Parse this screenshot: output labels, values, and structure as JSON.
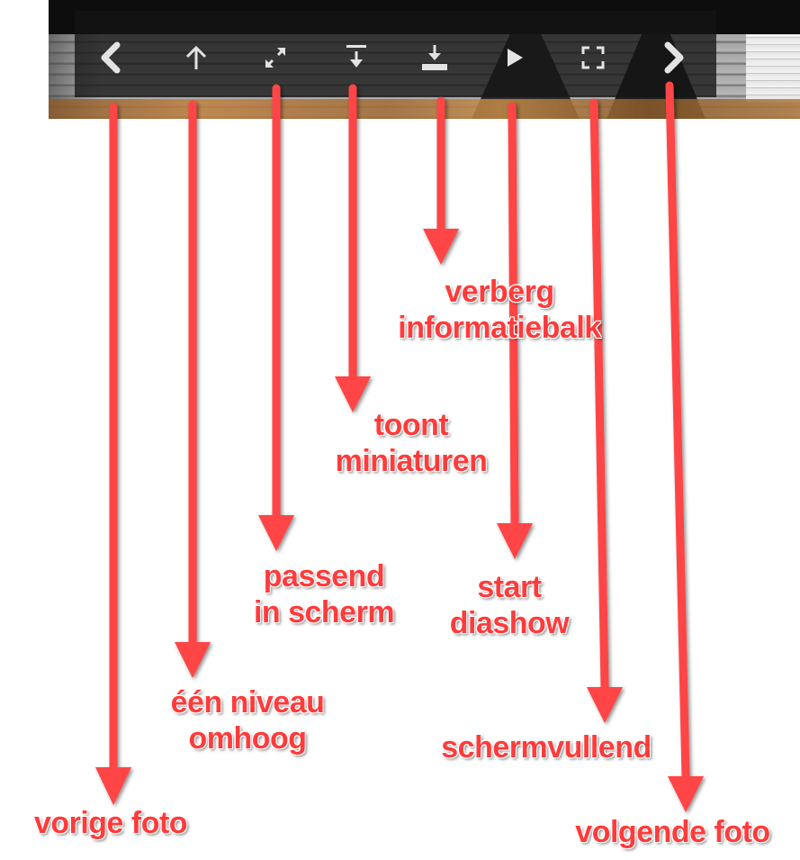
{
  "toolbar": {
    "buttons": [
      {
        "icon": "chevron-left-icon",
        "function": "previous-photo"
      },
      {
        "icon": "arrow-up-icon",
        "function": "one-level-up"
      },
      {
        "icon": "expand-diagonal-icon",
        "function": "fit-to-screen"
      },
      {
        "icon": "show-thumbnails-icon",
        "function": "show-thumbnails"
      },
      {
        "icon": "hide-info-panel-icon",
        "function": "hide-info-panel"
      },
      {
        "icon": "play-icon",
        "function": "start-slideshow"
      },
      {
        "icon": "fullscreen-corners-icon",
        "function": "fullscreen"
      },
      {
        "icon": "chevron-right-icon",
        "function": "next-photo"
      }
    ]
  },
  "annotations": {
    "previous_photo": {
      "line1": "vorige foto"
    },
    "one_level_up": {
      "line1": "één niveau",
      "line2": "omhoog"
    },
    "fit_to_screen": {
      "line1": "passend",
      "line2": "in scherm"
    },
    "show_thumbnails": {
      "line1": "toont",
      "line2": "miniaturen"
    },
    "hide_info_panel": {
      "line1": "verberg",
      "line2": "informatiebalk"
    },
    "start_slideshow": {
      "line1": "start",
      "line2": "diashow"
    },
    "fullscreen": {
      "line1": "schermvullend"
    },
    "next_photo": {
      "line1": "volgende foto"
    }
  },
  "colors": {
    "annotation": "#ff3b3b",
    "toolbar_background": "#141414",
    "icon": "#e0e0e0"
  }
}
